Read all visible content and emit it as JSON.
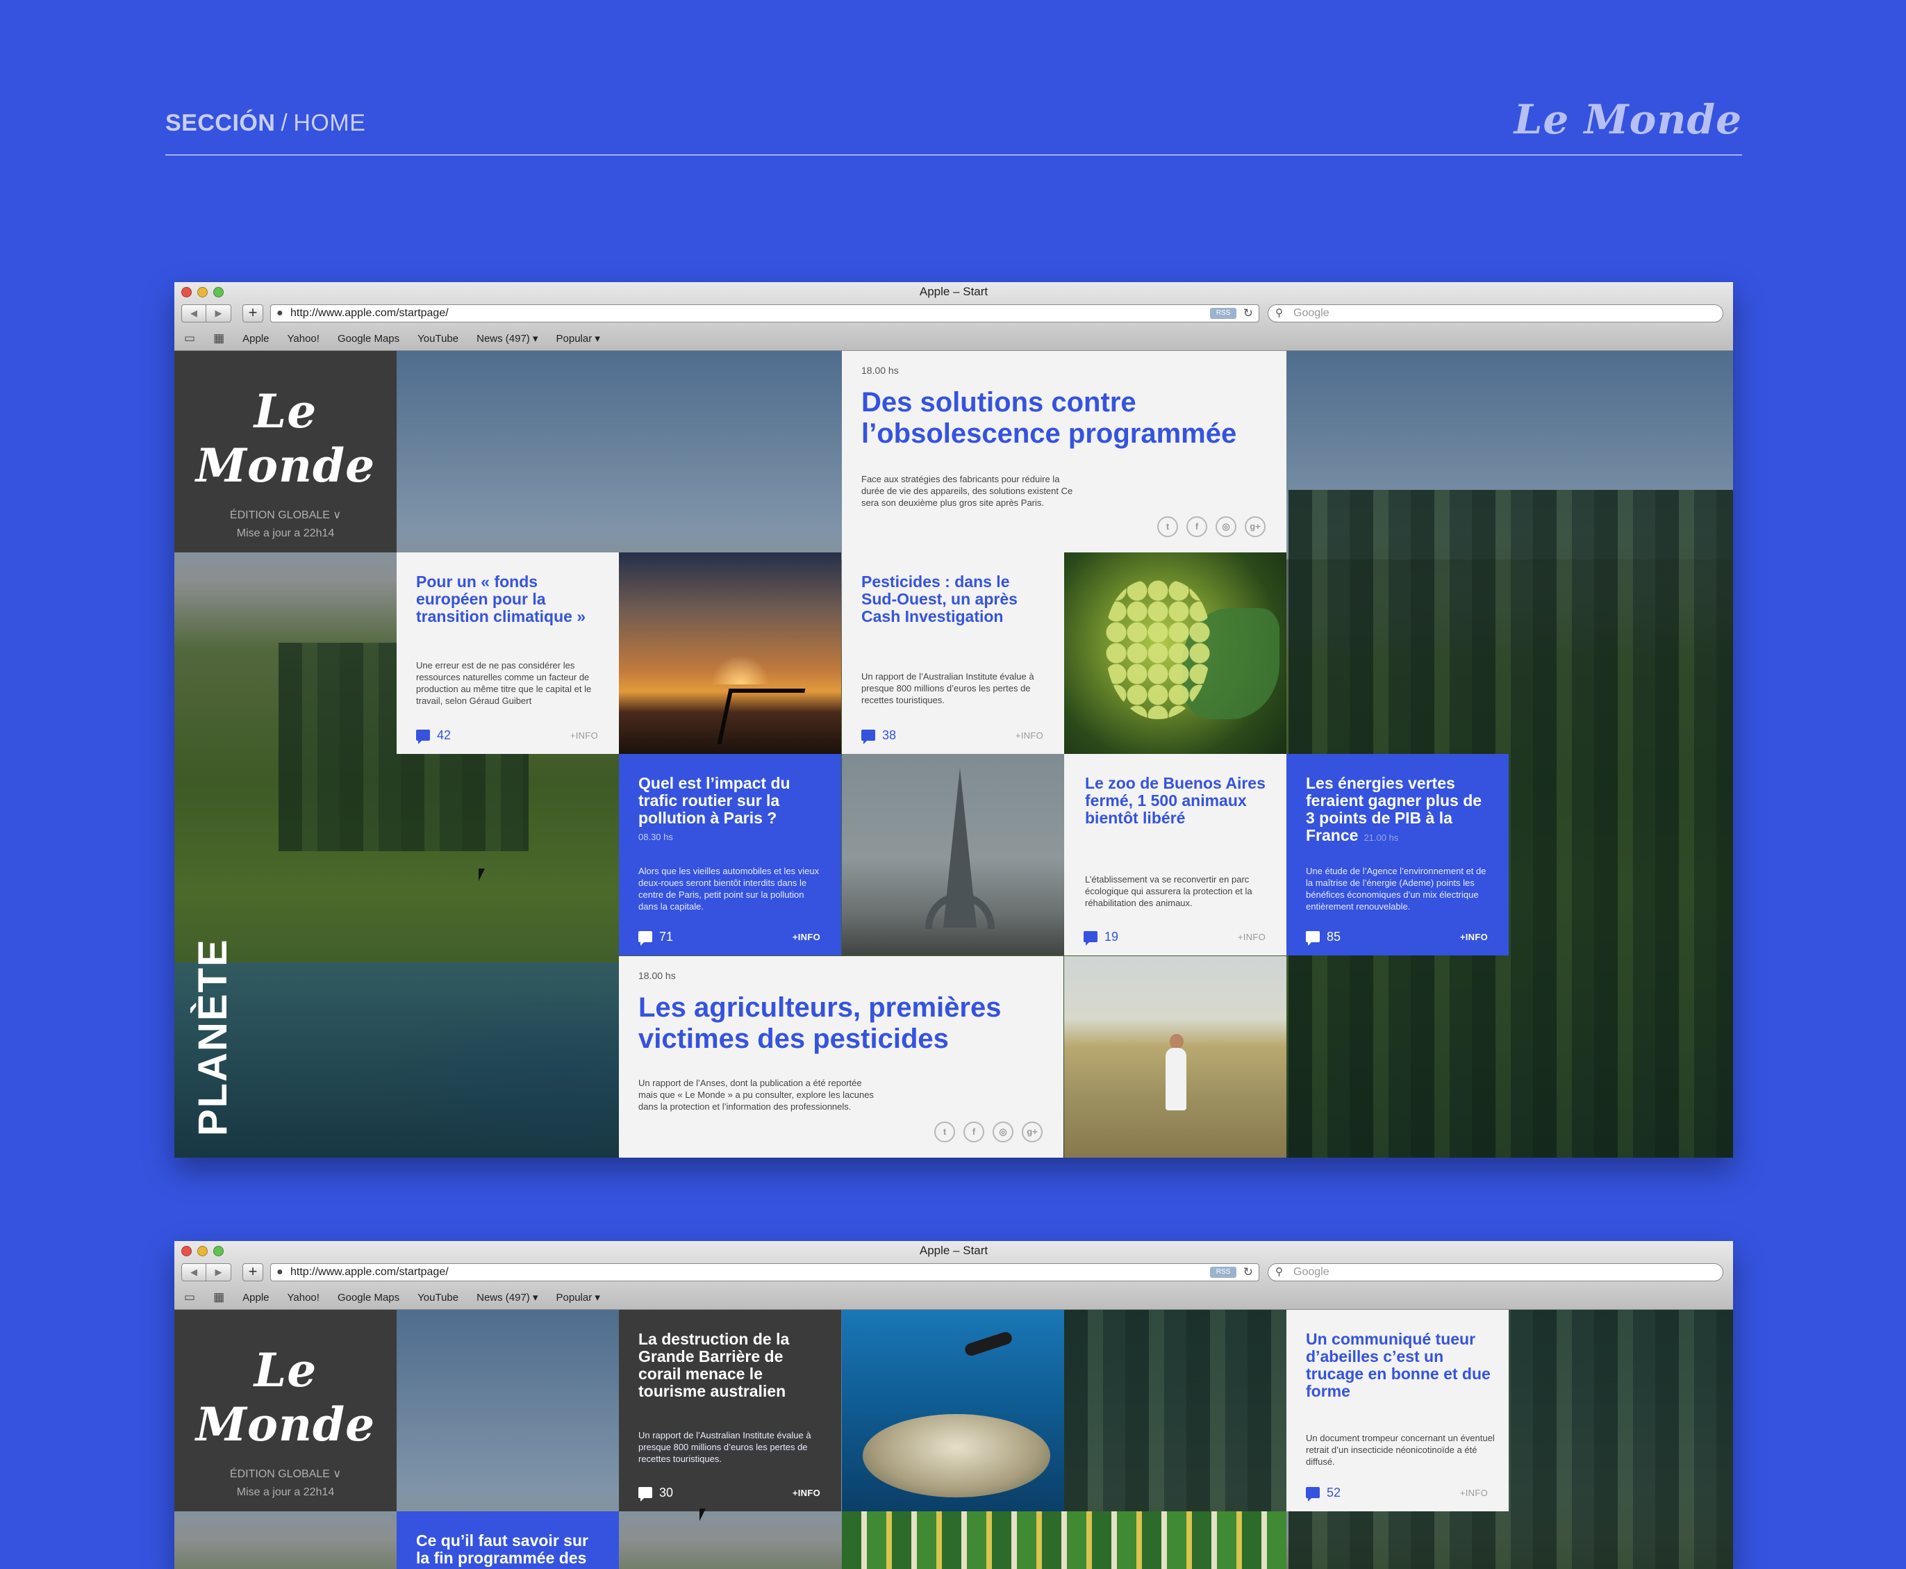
{
  "header": {
    "section_label": "SECCIÓN",
    "separator": "/",
    "page_label": "HOME",
    "brand": "Le Monde"
  },
  "browser": {
    "window_title": "Apple – Start",
    "url": "http://www.apple.com/startpage/",
    "rss_label": "RSS",
    "search_placeholder": "Google",
    "bookmarks": [
      "Apple",
      "Yahoo!",
      "Google Maps",
      "YouTube",
      "News (497) ▾",
      "Popular ▾"
    ]
  },
  "site": {
    "logo": "Le Monde",
    "edition": "ÉDITION GLOBALE ∨",
    "updated": "Mise a jour a 22h14",
    "section_vertical": "PLANÈTE",
    "more_label": "+INFO",
    "social_icons": [
      "twitter-icon",
      "facebook-icon",
      "instagram-icon",
      "google-plus-icon"
    ]
  },
  "screen1": {
    "feature_top": {
      "stamp": "18.00 hs",
      "title": "Des solutions contre l’obsolescence programmée",
      "body": "Face aux stratégies des fabricants pour réduire la durée de vie des appareils, des solutions existent Ce sera son deuxième plus gros site après Paris."
    },
    "fonds": {
      "title": "Pour un « fonds européen pour la transition climatique »",
      "body": "Une erreur est de ne pas considérer les ressources naturelles comme un facteur de production au même titre que le capital et le travail, selon Géraud Guibert",
      "comments": "42"
    },
    "pesticides_so": {
      "title": "Pesticides : dans le Sud-Ouest, un après Cash Investigation",
      "body": "Un rapport de l’Australian Institute évalue à presque 800 millions d’euros les pertes de recettes touristiques.",
      "comments": "38"
    },
    "trafic": {
      "title": "Quel est l’impact du trafic routier sur la pollution à Paris ?",
      "stamp": "08.30 hs",
      "body": "Alors que les vieilles automobiles et les vieux deux-roues seront bientôt interdits dans le centre de Paris, petit point sur la pollution dans la capitale.",
      "comments": "71"
    },
    "zoo": {
      "title": "Le zoo de Buenos Aires fermé, 1 500 animaux bientôt libéré",
      "body": "L’établissement va se reconvertir en parc écologique qui assurera la protection et la réhabilitation des animaux.",
      "comments": "19"
    },
    "energies": {
      "title": "Les énergies vertes feraient gagner plus de 3 points de PIB à la France",
      "stamp": "21.00 hs",
      "body": "Une étude de l’Agence l’environnement et de la maîtrise de l’énergie (Ademe) points les bénéfices économiques d’un mix électrique entièrement renouvelable.",
      "comments": "85"
    },
    "feature_bottom": {
      "stamp": "18.00 hs",
      "title": "Les agriculteurs, premières victimes des pesticides",
      "body": "Un rapport de l’Anses, dont la publication a été reportée mais que « Le Monde » a pu consulter, explore les lacunes dans la protection et l’information des professionnels."
    }
  },
  "screen2": {
    "barriere": {
      "title": "La destruction de la Grande Barrière de corail menace le tourisme australien",
      "body": "Un rapport de l’Australian Institute évalue à presque 800 millions d’euros les pertes de recettes touristiques.",
      "comments": "30"
    },
    "abeilles": {
      "title": "Un communiqué tueur d’abeilles c’est un trucage en bonne et due forme",
      "body": "Un document trompeur concernant un éventuel retrait d’un insecticide néonicotinoïde a été diffusé.",
      "comments": "52"
    },
    "fin_programmee": {
      "title": "Ce qu’il faut savoir sur la fin programmée des"
    }
  }
}
